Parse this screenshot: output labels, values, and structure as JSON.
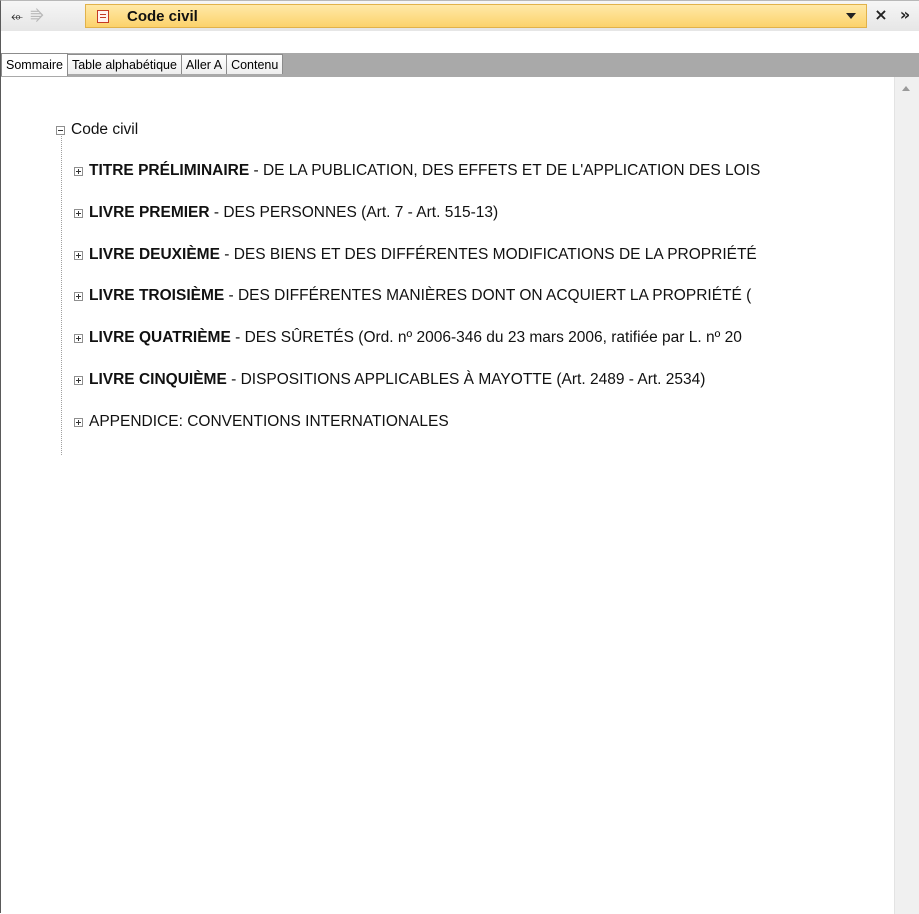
{
  "window": {
    "title": "Code civil"
  },
  "tabs": [
    {
      "label": "Sommaire",
      "selected": true
    },
    {
      "label": "Table alphabétique",
      "selected": false
    },
    {
      "label": "Aller A",
      "selected": false
    },
    {
      "label": "Contenu",
      "selected": false
    }
  ],
  "tree": {
    "root": {
      "label": "Code civil",
      "expanded": true
    },
    "items": [
      {
        "bold": "TITRE PRÉLIMINAIRE",
        "rest": " - DE LA PUBLICATION, DES EFFETS ET DE L'APPLICATION DES LOIS"
      },
      {
        "bold": "LIVRE PREMIER",
        "rest": " - DES PERSONNES (Art. 7 - Art. 515-13)"
      },
      {
        "bold": "LIVRE DEUXIÈME",
        "rest": " - DES BIENS ET DES DIFFÉRENTES MODIFICATIONS DE LA PROPRIÉTÉ"
      },
      {
        "bold": "LIVRE TROISIÈME",
        "rest": " - DES DIFFÉRENTES MANIÈRES DONT ON ACQUIERT LA PROPRIÉTÉ ("
      },
      {
        "bold": "LIVRE QUATRIÈME",
        "rest": " - DES SÛRETÉS (Ord. nº 2006-346 du 23 mars 2006, ratifiée par L. nº 20"
      },
      {
        "bold": "LIVRE CINQUIÈME",
        "rest": " - DISPOSITIONS APPLICABLES À MAYOTTE (Art. 2489 - Art. 2534)"
      },
      {
        "bold": "",
        "rest": "APPENDICE: CONVENTIONS INTERNATIONALES"
      }
    ]
  },
  "colors": {
    "active_title_bg": "#fcd26b",
    "tab_band": "#a9a9a9"
  },
  "icons": {
    "back": "arrow-left-icon",
    "forward": "arrow-right-icon",
    "document": "document-icon",
    "dropdown": "chevron-down-icon",
    "close": "close-icon",
    "overflow": "double-chevron-right-icon"
  }
}
